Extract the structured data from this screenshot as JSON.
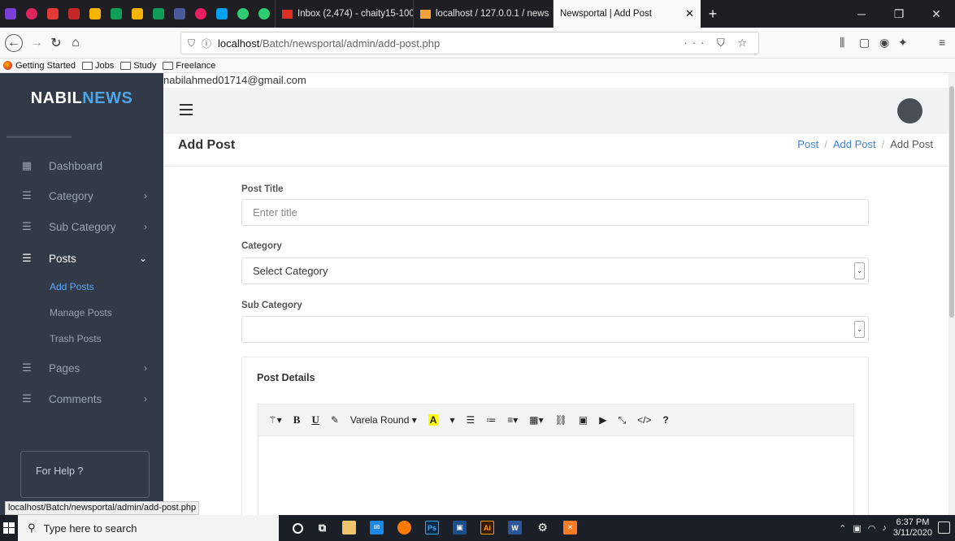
{
  "browser": {
    "tabs": [
      {
        "label": "Inbox (2,474) - chaity15-100",
        "color": "#d93025"
      },
      {
        "label": "localhost / 127.0.0.1 / news",
        "color": "#f2a33a"
      },
      {
        "label": "Newsportal | Add Post",
        "color": "#ffffff"
      }
    ],
    "url": {
      "host": "localhost",
      "path": "/Batch/newsportal/admin/add-post.php"
    },
    "bookmarks": [
      "Getting Started",
      "Jobs",
      "Study",
      "Freelance"
    ]
  },
  "app": {
    "brand_part1": "NABIL",
    "brand_part2": "NEWS",
    "brand_colors": {
      "primary": "#ffffff",
      "accent": "#4fa5e8"
    },
    "user_email": "nabilahmed01714@gmail.com"
  },
  "sidebar": {
    "items": [
      {
        "label": "Dashboard",
        "icon": "dashboard-icon"
      },
      {
        "label": "Category",
        "icon": "list-icon"
      },
      {
        "label": "Sub Category",
        "icon": "list-icon"
      },
      {
        "label": "Posts",
        "icon": "list-icon"
      },
      {
        "label": "Pages",
        "icon": "list-icon"
      },
      {
        "label": "Comments",
        "icon": "list-icon"
      }
    ],
    "posts_sub": [
      "Add Posts",
      "Manage Posts",
      "Trash Posts"
    ],
    "help_label": "For Help ?"
  },
  "page": {
    "title": "Add Post",
    "breadcrumb": [
      "Post",
      "Add Post",
      "Add Post"
    ]
  },
  "form": {
    "post_title_label": "Post Title",
    "post_title_placeholder": "Enter title",
    "category_label": "Category",
    "category_value": "Select Category",
    "subcategory_label": "Sub Category",
    "subcategory_value": "",
    "details_label": "Post Details",
    "toolbar": {
      "font_name": "Varela Round"
    }
  },
  "status_url": "localhost/Batch/newsportal/admin/add-post.php",
  "taskbar": {
    "search_placeholder": "Type here to search",
    "time": "6:37 PM",
    "date": "3/11/2020"
  }
}
